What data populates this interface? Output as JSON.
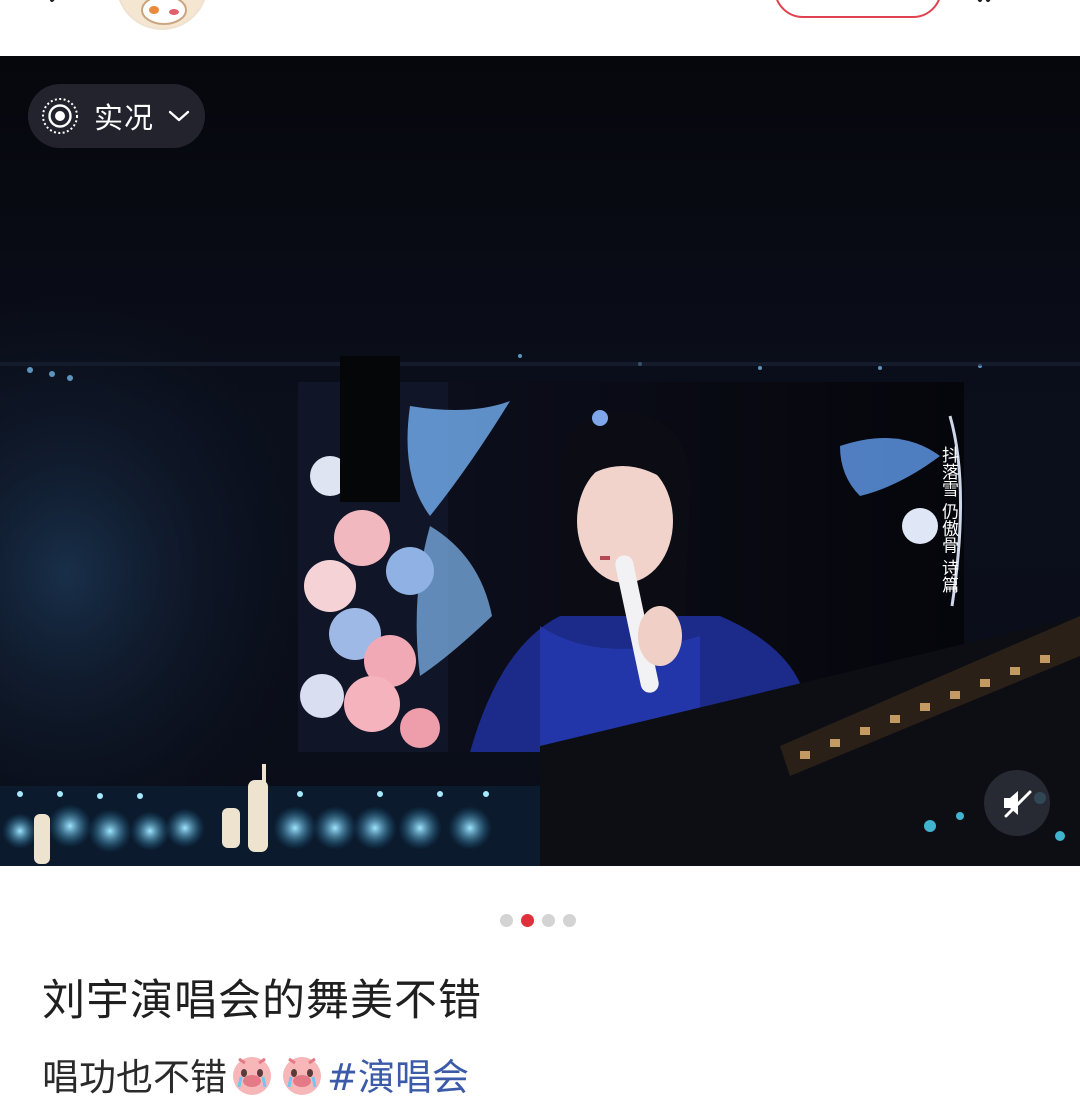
{
  "header": {
    "back_icon": "chevron-left-icon",
    "share_icon": "share-icon"
  },
  "media": {
    "live_badge_label": "实况",
    "live_icon": "live-photo-icon",
    "dropdown_icon": "chevron-down-icon",
    "mute_icon": "sound-off-icon",
    "screen_caption": "抖落雪 仍傲骨 诗篇"
  },
  "pagination": {
    "total": 4,
    "current": 2,
    "active_color": "#e0303c"
  },
  "post": {
    "title": "刘宇演唱会的舞美不错",
    "body_text": "唱功也不错",
    "emoji_icon": "crying-pig-emoji-icon",
    "hashtag": "#演唱会"
  },
  "colors": {
    "accent": "#e0424f",
    "hashtag": "#3b5aa8"
  }
}
